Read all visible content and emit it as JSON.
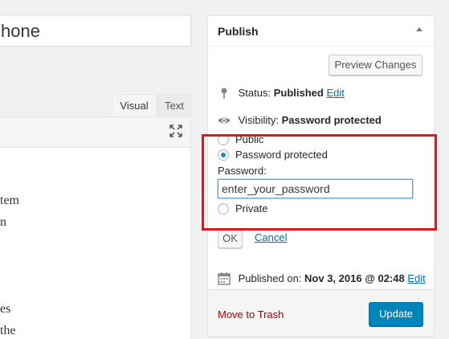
{
  "editor": {
    "title_value": "hone",
    "tabs": [
      {
        "label": "Visual"
      },
      {
        "label": "Text"
      }
    ],
    "content_lines": [
      "tem",
      "n",
      "",
      "",
      "",
      "es",
      "the"
    ]
  },
  "publish": {
    "title": "Publish",
    "preview_label": "Preview Changes",
    "status_label": "Status:",
    "status_value": "Published",
    "status_edit": "Edit",
    "visibility_label": "Visibility:",
    "visibility_value": "Password protected",
    "options": [
      {
        "label": "Public",
        "checked": false
      },
      {
        "label": "Password protected",
        "checked": true
      },
      {
        "label": "Private",
        "checked": false
      }
    ],
    "password_label": "Password:",
    "password_value": "enter_your_password",
    "ok_label": "OK",
    "cancel_label": "Cancel",
    "published_label": "Published on:",
    "published_value": "Nov 3, 2016 @ 02:48",
    "published_edit": "Edit",
    "trash_label": "Move to Trash",
    "update_label": "Update"
  },
  "colors": {
    "accent": "#0085ba",
    "link": "#0073aa",
    "trash": "#aa0000",
    "highlight": "#e2171e"
  }
}
